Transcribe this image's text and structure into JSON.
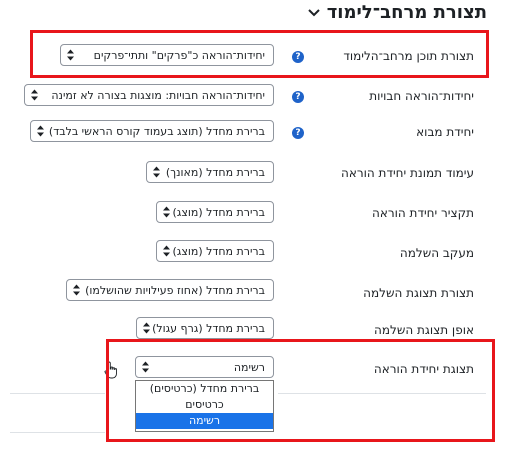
{
  "section": {
    "title": "תצורת מרחב־לימוד",
    "icon": "chevron-down-icon"
  },
  "settings": [
    {
      "label": "תצורת תוכן מרחב־הלימוד",
      "value": "יחידות־הוראה כ\"פרקים\" ותתי־פרקים",
      "help": true
    },
    {
      "label": "יחידות־הוראה חבויות",
      "value": "יחידות־הוראה חבויות: מוצגות בצורה לא זמינה",
      "help": true
    },
    {
      "label": "יחידת מבוא",
      "value": "ברירת מחדל (תוצג בעמוד קורס הראשי בלבד)",
      "help": true
    },
    {
      "label": "עימוד תמונת יחידת הוראה",
      "value": "ברירת מחדל (מאונך)",
      "help": false
    },
    {
      "label": "תקציר יחידת הוראה",
      "value": "ברירת מחדל (מוצג)",
      "help": false
    },
    {
      "label": "מעקב השלמה",
      "value": "ברירת מחדל (מוצג)",
      "help": false
    },
    {
      "label": "תצורת תצוגת השלמה",
      "value": "ברירת מחדל (אחוז פעילויות שהושלמו)",
      "help": false
    },
    {
      "label": "אופן תצוגת השלמה",
      "value": "ברירת מחדל (גרף עגול)",
      "help": false
    },
    {
      "label": "תצוגת יחידת הוראה",
      "value": "רשימה",
      "help": false
    }
  ],
  "dropdown": {
    "options": [
      "ברירת מחדל (כרטיסים)",
      "כרטיסים",
      "רשימה"
    ],
    "selected_index": 2
  },
  "colors": {
    "highlight": "#e8161b",
    "help_icon": "#1f63c9",
    "selected_option": "#1a73e8"
  },
  "help_glyph": "?"
}
